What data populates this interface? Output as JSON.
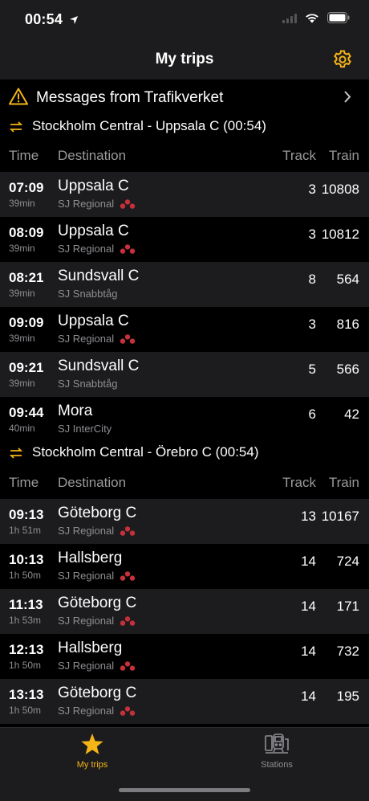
{
  "status_bar": {
    "time": "00:54"
  },
  "nav": {
    "title": "My trips"
  },
  "messages": {
    "label": "Messages from Trafikverket"
  },
  "columns": {
    "time": "Time",
    "destination": "Destination",
    "track": "Track",
    "train": "Train"
  },
  "sections": [
    {
      "title": "Stockholm Central - Uppsala C (00:54)",
      "rows": [
        {
          "time": "07:09",
          "duration": "39min",
          "destination": "Uppsala C",
          "operator": "SJ Regional",
          "track": "3",
          "train": "10808",
          "sj_logo": true
        },
        {
          "time": "08:09",
          "duration": "39min",
          "destination": "Uppsala C",
          "operator": "SJ Regional",
          "track": "3",
          "train": "10812",
          "sj_logo": true
        },
        {
          "time": "08:21",
          "duration": "39min",
          "destination": "Sundsvall C",
          "operator": "SJ Snabbtåg",
          "track": "8",
          "train": "564",
          "sj_logo": false
        },
        {
          "time": "09:09",
          "duration": "39min",
          "destination": "Uppsala C",
          "operator": "SJ Regional",
          "track": "3",
          "train": "816",
          "sj_logo": true
        },
        {
          "time": "09:21",
          "duration": "39min",
          "destination": "Sundsvall C",
          "operator": "SJ Snabbtåg",
          "track": "5",
          "train": "566",
          "sj_logo": false
        },
        {
          "time": "09:44",
          "duration": "40min",
          "destination": "Mora",
          "operator": "SJ InterCity",
          "track": "6",
          "train": "42",
          "sj_logo": false
        }
      ]
    },
    {
      "title": "Stockholm Central - Örebro C (00:54)",
      "rows": [
        {
          "time": "09:13",
          "duration": "1h 51m",
          "destination": "Göteborg C",
          "operator": "SJ Regional",
          "track": "13",
          "train": "10167",
          "sj_logo": true
        },
        {
          "time": "10:13",
          "duration": "1h 50m",
          "destination": "Hallsberg",
          "operator": "SJ Regional",
          "track": "14",
          "train": "724",
          "sj_logo": true
        },
        {
          "time": "11:13",
          "duration": "1h 53m",
          "destination": "Göteborg C",
          "operator": "SJ Regional",
          "track": "14",
          "train": "171",
          "sj_logo": true
        },
        {
          "time": "12:13",
          "duration": "1h 50m",
          "destination": "Hallsberg",
          "operator": "SJ Regional",
          "track": "14",
          "train": "732",
          "sj_logo": true
        },
        {
          "time": "13:13",
          "duration": "1h 50m",
          "destination": "Göteborg C",
          "operator": "SJ Regional",
          "track": "14",
          "train": "195",
          "sj_logo": true
        }
      ]
    }
  ],
  "tabs": [
    {
      "label": "My trips",
      "icon": "star-icon",
      "active": true
    },
    {
      "label": "Stations",
      "icon": "train-station-icon",
      "active": false
    }
  ],
  "colors": {
    "accent": "#f5b417",
    "sj_red": "#c5303a",
    "row_alt": "#1c1c1e"
  }
}
